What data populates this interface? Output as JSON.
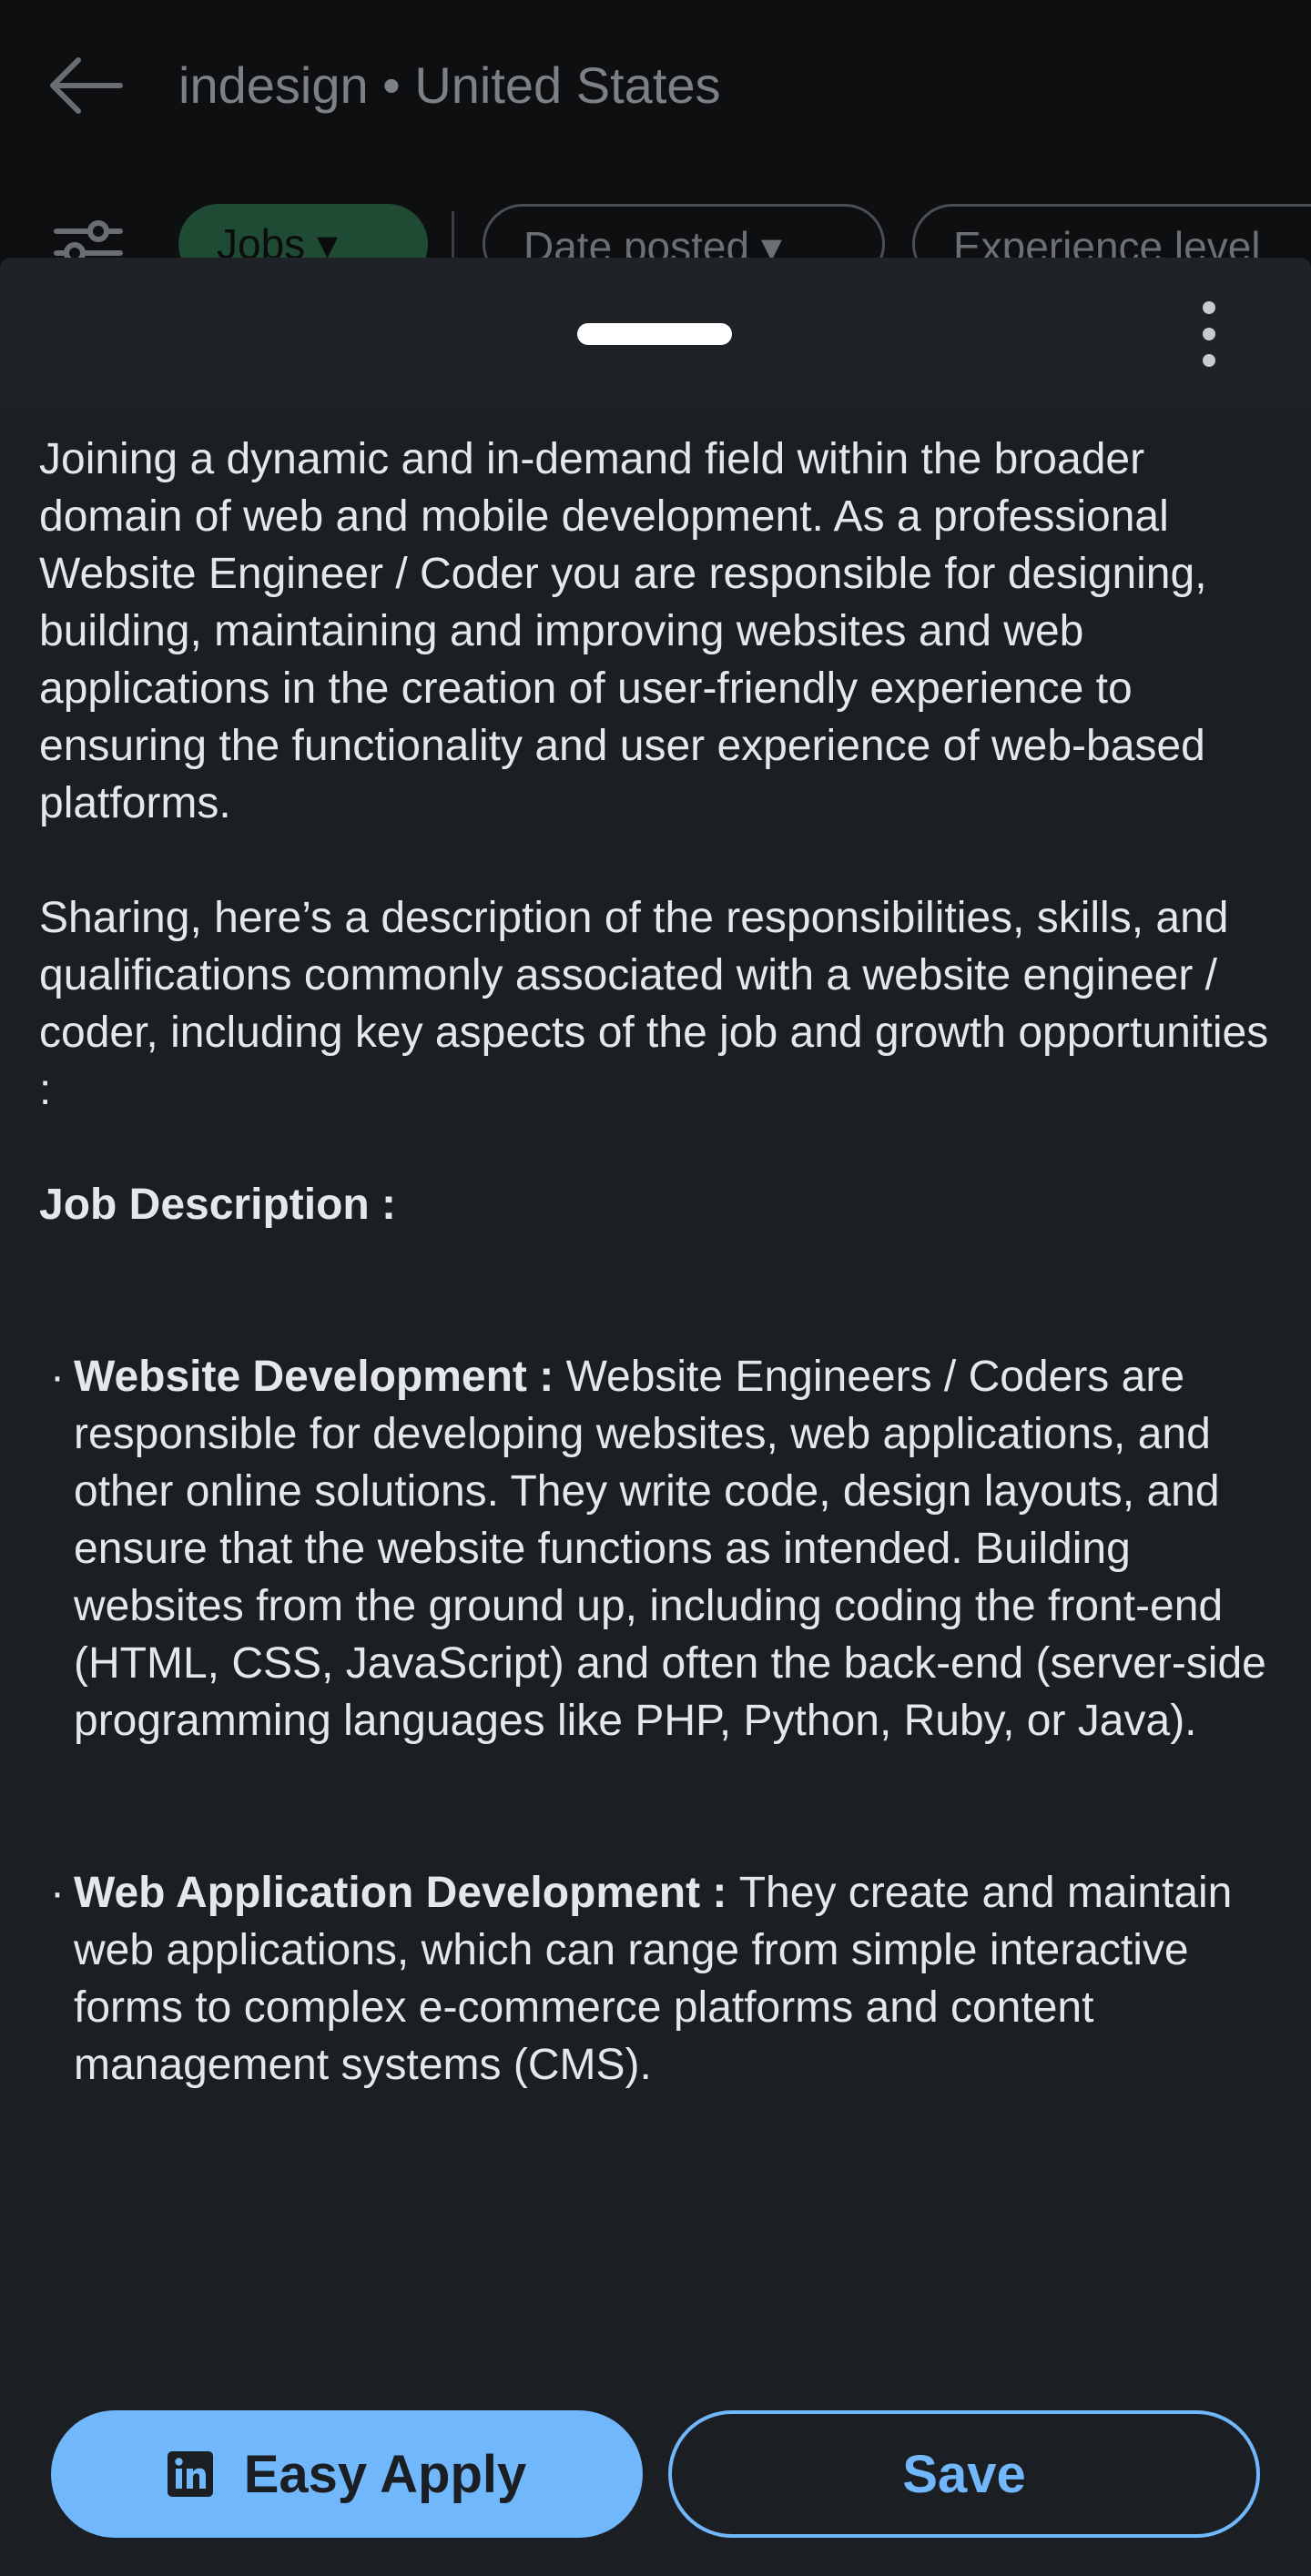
{
  "search_header": {
    "query": "indesign • United States",
    "chips": [
      {
        "label": "Jobs",
        "active": true
      },
      {
        "label": "Date posted",
        "active": false
      },
      {
        "label": "Experience level",
        "active": false
      }
    ]
  },
  "job_description": {
    "intro": "Joining a dynamic and in-demand field within the broader domain of web and mobile development. As a professional Website Engineer / Coder you are responsible for designing, building, maintaining and improving websites and web applications in the creation of user-friendly experience to ensuring the functionality and user experience of web-based platforms.",
    "sharing": "Sharing, here’s a description of the responsibilities, skills, and qualifications commonly associated with a website engineer / coder, including key aspects of the job and growth opportunities :",
    "section_heading": "Job Description :",
    "bullets": [
      {
        "title": "Website Development :",
        "text": "Website Engineers / Coders are responsible for developing websites, web applications, and other online solutions. They write code, design layouts, and ensure that the website functions as intended. Building websites from the ground up, including coding the front-end (HTML, CSS, JavaScript) and often the back-end (server-side programming languages like PHP, Python, Ruby, or Java)."
      },
      {
        "title": "Web Application Development :",
        "text": "They create and maintain web applications, which can range from simple interactive forms to complex e-commerce platforms and content management systems (CMS)."
      }
    ]
  },
  "actions": {
    "easy_apply_label": "Easy Apply",
    "save_label": "Save"
  },
  "colors": {
    "accent": "#71b7fb",
    "sheet_bg": "#1b1f23",
    "active_chip": "#1f4a34"
  },
  "icons": [
    "back-arrow-icon",
    "filter-sliders-icon",
    "chevron-down-icon",
    "more-vertical-icon",
    "linkedin-icon"
  ]
}
